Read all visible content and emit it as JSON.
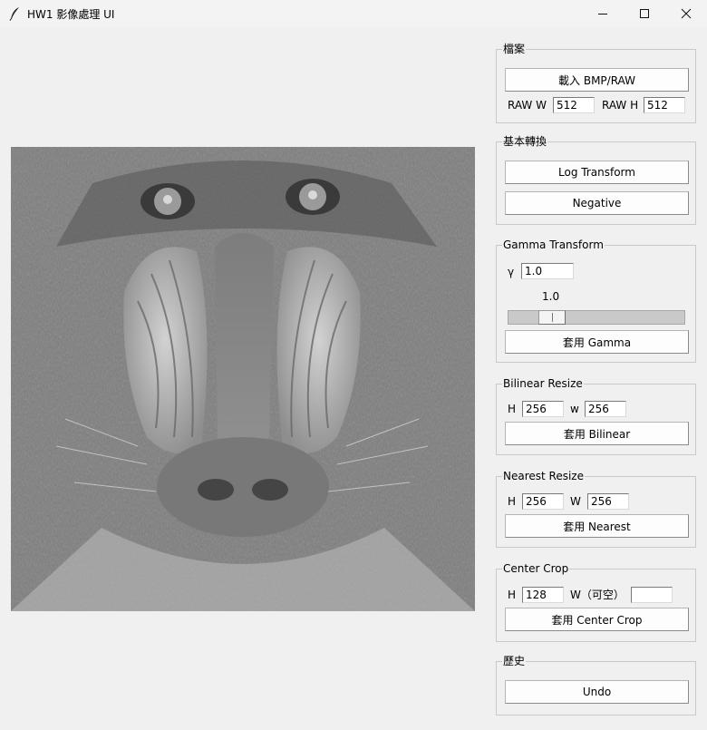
{
  "window": {
    "title": "HW1 影像處理 UI"
  },
  "file_group": {
    "label": "檔案",
    "load_button": "載入 BMP/RAW",
    "raw_w_label": "RAW W",
    "raw_w_value": "512",
    "raw_h_label": "RAW H",
    "raw_h_value": "512"
  },
  "basic_group": {
    "label": "基本轉換",
    "log_button": "Log Transform",
    "negative_button": "Negative"
  },
  "gamma_group": {
    "label": "Gamma Transform",
    "gamma_label": "γ",
    "gamma_value": "1.0",
    "slider_value_text": "1.0",
    "slider_level": 0.2,
    "apply_button": "套用 Gamma"
  },
  "bilinear_group": {
    "label": "Bilinear Resize",
    "h_label": "H",
    "h_value": "256",
    "w_label": "w",
    "w_value": "256",
    "apply_button": "套用 Bilinear"
  },
  "nearest_group": {
    "label": "Nearest Resize",
    "h_label": "H",
    "h_value": "256",
    "w_label": "W",
    "w_value": "256",
    "apply_button": "套用 Nearest"
  },
  "crop_group": {
    "label": "Center Crop",
    "h_label": "H",
    "h_value": "128",
    "w_label": "W（可空）",
    "w_value": "",
    "apply_button": "套用 Center Crop"
  },
  "history_group": {
    "label": "歷史",
    "undo_button": "Undo"
  },
  "image": {
    "subject": "grayscale mandrill baboon face"
  },
  "colors": {
    "window_bg": "#f0f0f0",
    "frame_border": "#c9c9c9",
    "button_bg": "#fdfdfd"
  }
}
